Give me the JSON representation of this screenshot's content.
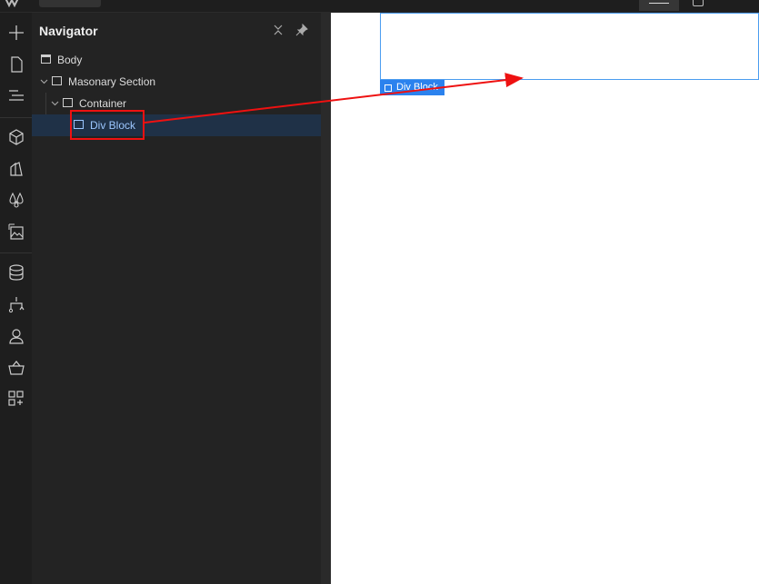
{
  "navigator": {
    "title": "Navigator",
    "tree": [
      {
        "label": "Body"
      },
      {
        "label": "Masonary Section"
      },
      {
        "label": "Container"
      },
      {
        "label": "Div Block"
      }
    ]
  },
  "canvas": {
    "selected_tag": "Div Block"
  },
  "colors": {
    "accent": "#2b82ee",
    "selection_bg": "#1f3147",
    "annotation": "#e11111"
  },
  "icons": [
    "plus-icon",
    "page-icon",
    "navigator-icon",
    "cube-icon",
    "style-icon",
    "color-icon",
    "assets-icon",
    "cms-icon",
    "logic-icon",
    "users-icon",
    "ecommerce-icon",
    "apps-icon"
  ]
}
